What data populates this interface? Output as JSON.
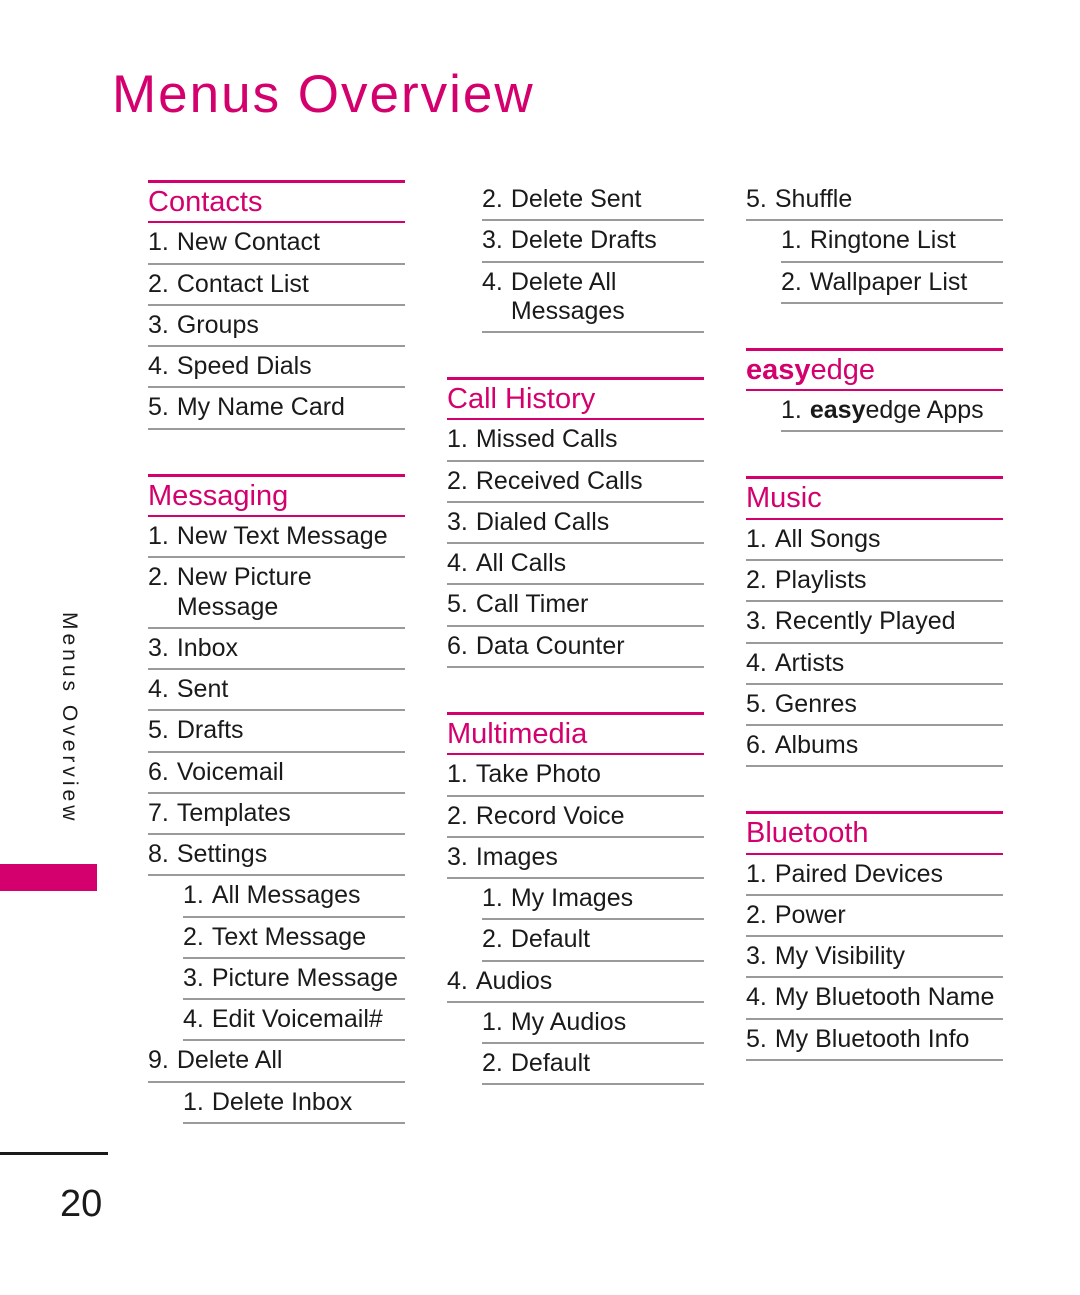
{
  "page": {
    "title": "Menus Overview",
    "side_label": "Menus Overview",
    "number": "20"
  },
  "columns": [
    {
      "sections": [
        {
          "heading": "Contacts",
          "heading_html": "Contacts",
          "items": [
            {
              "num": "1.",
              "text": "New Contact",
              "level": 0
            },
            {
              "num": "2.",
              "text": "Contact List",
              "level": 0
            },
            {
              "num": "3.",
              "text": "Groups",
              "level": 0
            },
            {
              "num": "4.",
              "text": "Speed Dials",
              "level": 0
            },
            {
              "num": "5.",
              "text": "My Name Card",
              "level": 0
            }
          ]
        },
        {
          "heading": "Messaging",
          "heading_html": "Messaging",
          "items": [
            {
              "num": "1.",
              "text": "New Text Message",
              "level": 0
            },
            {
              "num": "2.",
              "text": "New Picture Message",
              "level": 0
            },
            {
              "num": "3.",
              "text": "Inbox",
              "level": 0
            },
            {
              "num": "4.",
              "text": "Sent",
              "level": 0
            },
            {
              "num": "5.",
              "text": "Drafts",
              "level": 0
            },
            {
              "num": "6.",
              "text": "Voicemail",
              "level": 0
            },
            {
              "num": "7.",
              "text": "Templates",
              "level": 0
            },
            {
              "num": "8.",
              "text": "Settings",
              "level": 0
            },
            {
              "num": "1.",
              "text": "All Messages",
              "level": 1
            },
            {
              "num": "2.",
              "text": "Text Message",
              "level": 1
            },
            {
              "num": "3.",
              "text": "Picture Message",
              "level": 1
            },
            {
              "num": "4.",
              "text": "Edit Voicemail#",
              "level": 1
            },
            {
              "num": "9.",
              "text": "Delete All",
              "level": 0
            },
            {
              "num": "1.",
              "text": "Delete Inbox",
              "level": 1
            }
          ]
        }
      ]
    },
    {
      "sections": [
        {
          "heading": "",
          "heading_html": "",
          "continuation": true,
          "items": [
            {
              "num": "2.",
              "text": "Delete Sent",
              "level": 1
            },
            {
              "num": "3.",
              "text": "Delete Drafts",
              "level": 1
            },
            {
              "num": "4.",
              "text": "Delete All Messages",
              "level": 1
            }
          ]
        },
        {
          "heading": "Call History",
          "heading_html": "Call History",
          "items": [
            {
              "num": "1.",
              "text": "Missed Calls",
              "level": 0
            },
            {
              "num": "2.",
              "text": "Received Calls",
              "level": 0
            },
            {
              "num": "3.",
              "text": "Dialed Calls",
              "level": 0
            },
            {
              "num": "4.",
              "text": "All Calls",
              "level": 0
            },
            {
              "num": "5.",
              "text": "Call Timer",
              "level": 0
            },
            {
              "num": "6.",
              "text": "Data Counter",
              "level": 0
            }
          ]
        },
        {
          "heading": "Multimedia",
          "heading_html": "Multimedia",
          "items": [
            {
              "num": "1.",
              "text": "Take Photo",
              "level": 0
            },
            {
              "num": "2.",
              "text": "Record Voice",
              "level": 0
            },
            {
              "num": "3.",
              "text": "Images",
              "level": 0
            },
            {
              "num": "1.",
              "text": "My Images",
              "level": 1
            },
            {
              "num": "2.",
              "text": "Default",
              "level": 1
            },
            {
              "num": "4.",
              "text": "Audios",
              "level": 0
            },
            {
              "num": "1.",
              "text": "My Audios",
              "level": 1
            },
            {
              "num": "2.",
              "text": "Default",
              "level": 1
            }
          ]
        }
      ]
    },
    {
      "sections": [
        {
          "heading": "",
          "heading_html": "",
          "continuation": true,
          "items": [
            {
              "num": "5.",
              "text": "Shuffle",
              "level": 0
            },
            {
              "num": "1.",
              "text": "Ringtone List",
              "level": 1
            },
            {
              "num": "2.",
              "text": "Wallpaper List",
              "level": 1
            }
          ]
        },
        {
          "heading": "easyedge",
          "heading_html": "<b>easy</b>edge",
          "items": [
            {
              "num": "1.",
              "text": "easyedge Apps",
              "html": "<b>easy</b>edge Apps",
              "level": 1
            }
          ]
        },
        {
          "heading": "Music",
          "heading_html": "Music",
          "items": [
            {
              "num": "1.",
              "text": "All Songs",
              "level": 0
            },
            {
              "num": "2.",
              "text": "Playlists",
              "level": 0
            },
            {
              "num": "3.",
              "text": "Recently Played",
              "level": 0
            },
            {
              "num": "4.",
              "text": "Artists",
              "level": 0
            },
            {
              "num": "5.",
              "text": "Genres",
              "level": 0
            },
            {
              "num": "6.",
              "text": "Albums",
              "level": 0
            }
          ]
        },
        {
          "heading": "Bluetooth",
          "heading_html": "Bluetooth",
          "items": [
            {
              "num": "1.",
              "text": "Paired Devices",
              "level": 0
            },
            {
              "num": "2.",
              "text": "Power",
              "level": 0
            },
            {
              "num": "3.",
              "text": "My Visibility",
              "level": 0
            },
            {
              "num": "4.",
              "text": "My Bluetooth Name",
              "level": 0
            },
            {
              "num": "5.",
              "text": "My Bluetooth Info",
              "level": 0
            }
          ]
        }
      ]
    }
  ],
  "colors": {
    "accent": "#d3006d",
    "text": "#1a1a1a",
    "rule": "#9a9a9a"
  }
}
